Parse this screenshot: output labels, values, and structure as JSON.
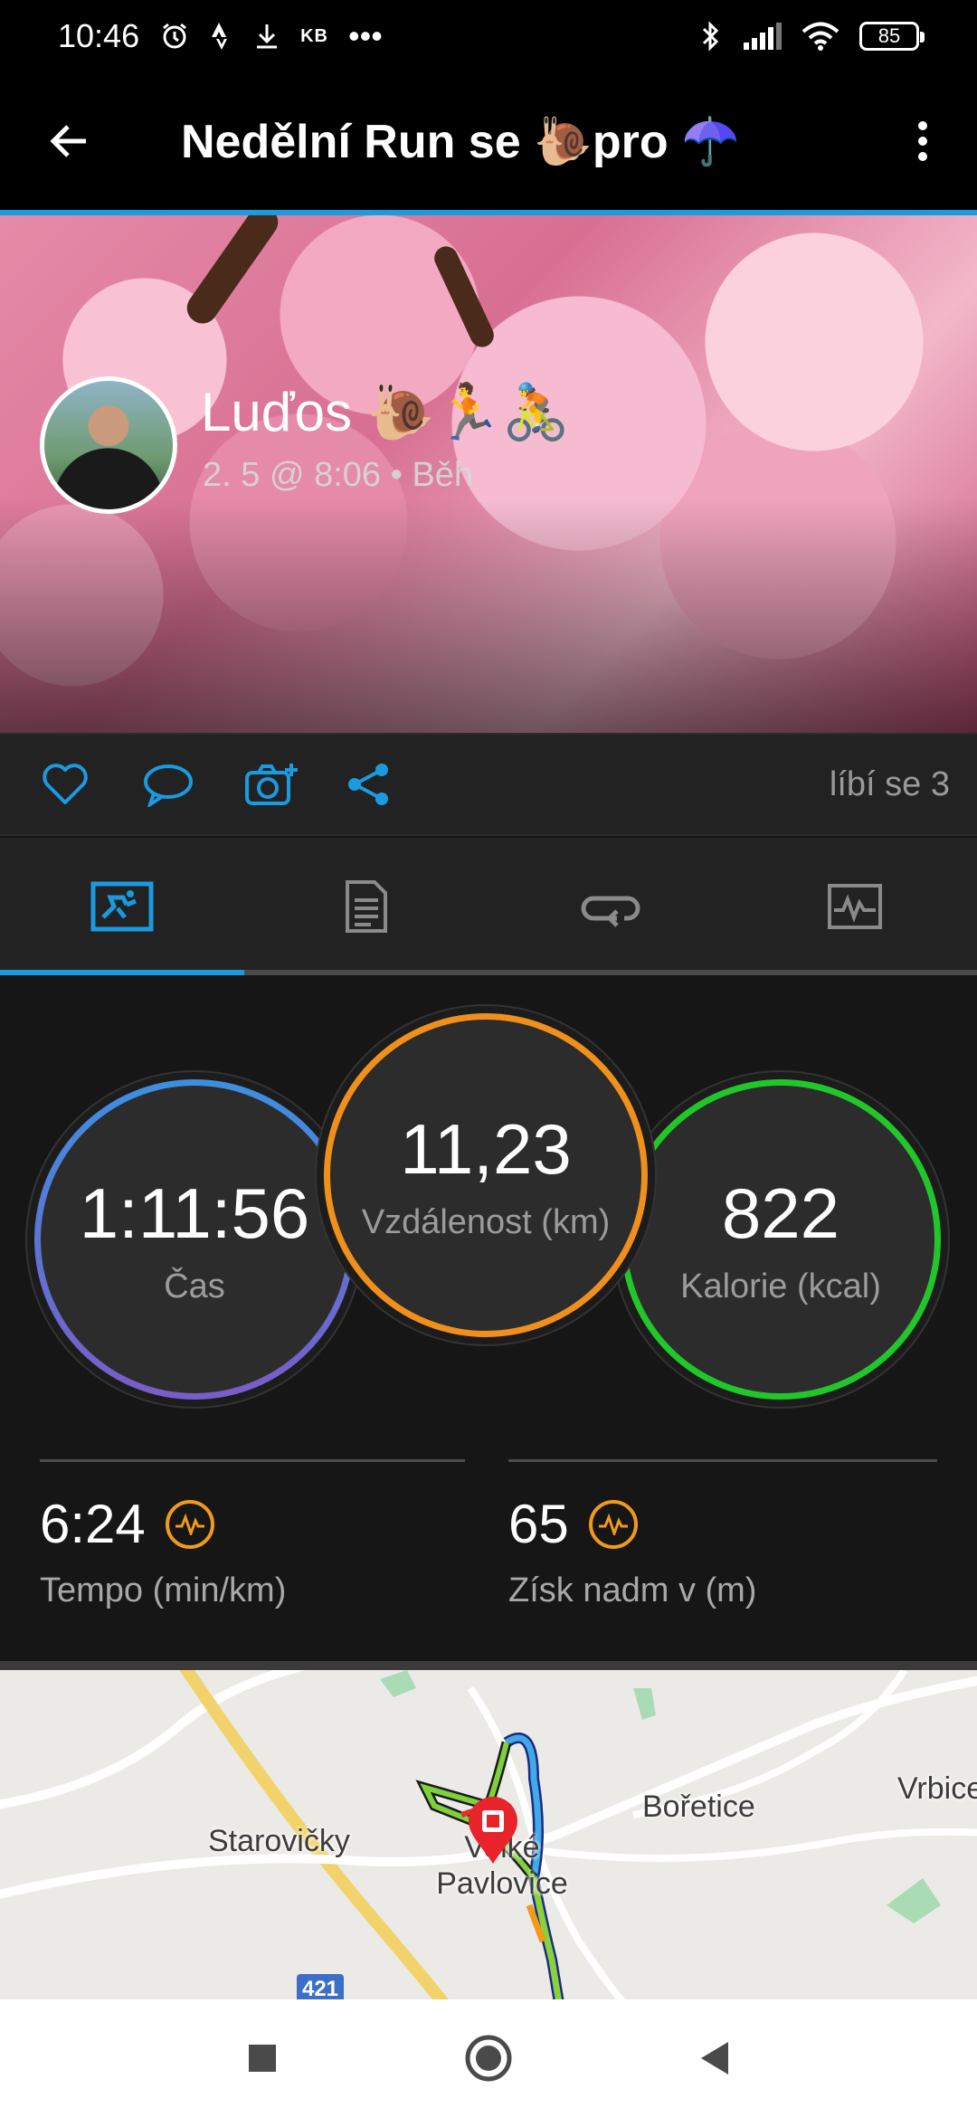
{
  "status_bar": {
    "time": "10:46",
    "kb_label": "KB",
    "more": "•••",
    "battery": "85"
  },
  "app_bar": {
    "title": "Nedělní Run se 🐌pro ☂️"
  },
  "activity": {
    "user_name": "Luďos 🐌🏃🚴",
    "meta": "2. 5 @ 8:06 • Běh"
  },
  "actions": {
    "likes": "líbí se 3"
  },
  "tabs": [
    {
      "name": "overview",
      "icon": "run-summary-icon"
    },
    {
      "name": "details",
      "icon": "document-icon"
    },
    {
      "name": "laps",
      "icon": "loop-icon"
    },
    {
      "name": "charts",
      "icon": "chart-icon"
    }
  ],
  "stats": {
    "time": {
      "value": "1:11:56",
      "label": "Čas"
    },
    "distance": {
      "value": "11,23",
      "label": "Vzdálenost (km)"
    },
    "calories": {
      "value": "822",
      "label": "Kalorie (kcal)"
    },
    "pace": {
      "value": "6:24",
      "label": "Tempo (min/km)"
    },
    "elevation": {
      "value": "65",
      "label": "Získ nadm v (m)"
    }
  },
  "map": {
    "towns": [
      "Starovičky",
      "Velké Pavlovice",
      "Bořetice",
      "Vrbice"
    ],
    "road_number": "421"
  },
  "colors": {
    "accent": "#1b9ae0",
    "distance_ring": "#f0901c",
    "calories_ring": "#21c72a",
    "time_ring_start": "#3d8fe0",
    "time_ring_end": "#7a5cc8"
  }
}
